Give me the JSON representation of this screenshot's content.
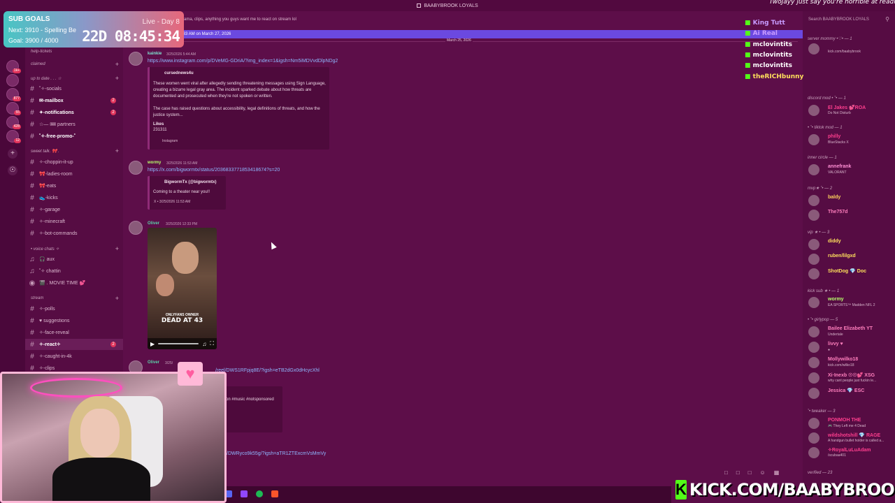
{
  "window": {
    "title": "BAABYBROOK LOYALS"
  },
  "sub_goals": {
    "title": "SUB GOALS",
    "next": "Next: 3910 - Spelling Be",
    "goal": "Goal: 3900 / 4000",
    "live": "Live - Day 8",
    "timer": "22D 08:45:34"
  },
  "server_rail": {
    "badges": [
      "1k+",
      "877",
      "55",
      "428",
      "12"
    ]
  },
  "sidebar": {
    "top_item": "help-tickets",
    "claimed": "claimed",
    "categories": [
      "up to date . . . ☆",
      "sweet talk. 🎀 .",
      "• voice chats ✧",
      "stream"
    ],
    "channels": [
      {
        "name": "˚✧-socials"
      },
      {
        "name": "✉-mailbox",
        "badge": "2"
      },
      {
        "name": "✦-notifications",
        "badge": "2"
      },
      {
        "name": "☆— 🎟 partners"
      },
      {
        "name": "˚✧-free-promo-˚"
      },
      {
        "name": "✧-choppin-it-up"
      },
      {
        "name": "🎀-ladies-room"
      },
      {
        "name": "🎀-eats"
      },
      {
        "name": "👟-kicks"
      },
      {
        "name": "✧-garage"
      },
      {
        "name": "✧-minecraft"
      },
      {
        "name": "✧-bot-commands"
      },
      {
        "name": "🎧 aux"
      },
      {
        "name": "˚✧ chattin"
      },
      {
        "name": "🎬 . MOVIE TIME 💕"
      },
      {
        "name": "✧-polls"
      },
      {
        "name": "♥ suggestions"
      },
      {
        "name": "✧-face-reveal"
      },
      {
        "name": "✧-react✧",
        "badge": "2"
      },
      {
        "name": "✧-caught-in-4k"
      },
      {
        "name": "✧-clips"
      }
    ]
  },
  "main": {
    "topic": "post updates, drama, clips, anything you guys want me to react on stream lol",
    "jump_bar": ":33 AM on March 27, 2026",
    "date_separator": "March 25, 2026",
    "messages": [
      {
        "author": "kainkie",
        "time": "3/25/2026 5:44 AM",
        "link": "https://www.instagram.com/p/DVeMG-GDriA/?img_index=1&igsh=Nm5iMDVvdDlpNDg2",
        "embed_author": "cursednews4u",
        "embed_text": "These women went viral after allegedly sending threatening messages using Sign Language, creating a bizarre legal gray area. The incident sparked debate about how threats are documented and prosecuted when they're not spoken or written.",
        "embed_text2": "The case has raised questions about accessibility, legal definitions of threats, and how the justice system...",
        "likes_label": "Likes",
        "likes_value": "231311",
        "footer": "Instagram"
      },
      {
        "author": "wormy",
        "time": "3/25/2026 11:53 AM",
        "link": "https://x.com/bigwormtx/status/2036833771853418674?s=20",
        "embed_author": "BigwormTx (@bigwormtx)",
        "embed_text": "Coming to a theater near you!!",
        "footer": "X • 3/25/2026 11:53 AM"
      },
      {
        "author": "Oliver",
        "time": "3/25/2026 12:33 PM",
        "video_caption_small": "ONLYFANS OWNER",
        "video_caption_big": "DEAD AT 43"
      },
      {
        "author": "Oliver",
        "time": "3/25/",
        "link": "/reel/DWS1RFpjq8E/?igsh=eTB2dGx0dHcycXhl",
        "partial_text": "son #music #notsponsored"
      }
    ],
    "last_link": "/DWRyco9k55g/?igsh=aTR1ZTExcmVsMmVy"
  },
  "members": {
    "search_placeholder": "Search BAABYBROOK LOYALS",
    "categories": [
      "server mommy •♡• — 1",
      "discord mod • ˚• — 1",
      "• ˚• tiktok mod — 1",
      "inner circle — 1",
      "mvp★ ˚• — 2",
      "vip ★ • — 3",
      "kick sub ★ • — 1",
      "• ˚• girlypop — 5",
      "˚• tweaker — 3",
      "verified — 23"
    ],
    "list": [
      {
        "name": "",
        "status": "kick.com/baabybrook",
        "color": "#ff6fcf"
      },
      {
        "name": "El Jakes 💕ROA",
        "status": "Do Not Disturb",
        "color": "#ff3e8e"
      },
      {
        "name": "philly",
        "status": "BlueStacks X",
        "color": "#ff3e8e"
      },
      {
        "name": "annefrank",
        "status": "VALORANT",
        "color": "#ff8fd4"
      },
      {
        "name": "baldy",
        "status": "",
        "color": "#ffd35c"
      },
      {
        "name": "The757d",
        "status": "",
        "color": "#ff7fbd"
      },
      {
        "name": "diddy",
        "status": "",
        "color": "#ffe05c"
      },
      {
        "name": "ruben/lilgxd",
        "status": "",
        "color": "#ffe05c"
      },
      {
        "name": "ShotDog 💎 Doc",
        "status": "",
        "color": "#ffe05c"
      },
      {
        "name": "wormy",
        "status": "EA SPORTS™ Madden NFL 2",
        "color": "#b6ff6b"
      },
      {
        "name": "Bailee Elizabeth YT",
        "status": "Undertale",
        "color": "#ff7fbd"
      },
      {
        "name": "livvy ♥",
        "status": "●",
        "color": "#ff7fbd"
      },
      {
        "name": "Mollywilko18",
        "status": "kick.com/wilko18",
        "color": "#ff7fbd"
      },
      {
        "name": "Xi‧Inexb ☉☉💕 XSG",
        "status": "why cant people just fuckin le...",
        "color": "#ff7fbd"
      },
      {
        "name": "Jessica 💎 ESC",
        "status": "",
        "color": "#ff7fbd"
      },
      {
        "name": "PONMOH THE",
        "status": "🎮 They Left me 4 Dead",
        "color": "#ff3e8e"
      },
      {
        "name": "wildshotshill 💎 RAGE",
        "status": "A handgun bullet holder is called a...",
        "color": "#ff3e8e"
      },
      {
        "name": "✧RoyalLuLuAdam",
        "status": "/scubaa401",
        "color": "#ff3e8e"
      }
    ]
  },
  "chat_overlay": {
    "first_message": "TwoJayy just say you're horrible at reading chat",
    "lines": [
      "King Tutt",
      "Ai Real",
      "mclovintits",
      "mclovintits",
      "mclovintits",
      "theRICHbunny"
    ]
  },
  "kick_banner": {
    "text": "KICK.COM/BAABYBROOK",
    "logo_letter": "K"
  }
}
